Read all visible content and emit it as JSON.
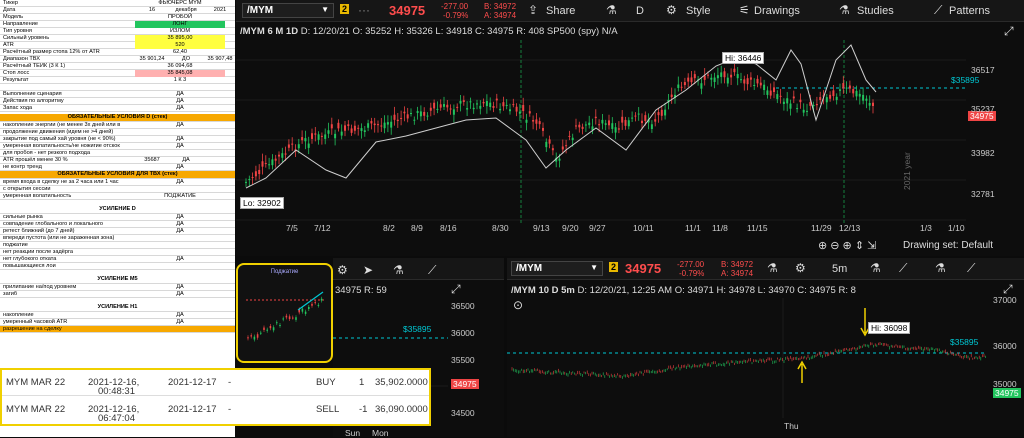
{
  "sheet": {
    "rows": [
      {
        "label": "Тикер",
        "values": [
          "ФЬЮЧЕРС MYM"
        ]
      },
      {
        "label": "Дата",
        "values": [
          "16",
          "декабря",
          "2021"
        ]
      },
      {
        "label": "Модель",
        "values": [
          "ПРОБОЙ"
        ]
      },
      {
        "label": "Направление",
        "values": [
          "ЛОНГ"
        ]
      },
      {
        "label": "Тип уровня",
        "values": [
          "ИЗЛОМ"
        ]
      },
      {
        "label": "Сильный уровень",
        "values": [
          "35 895,00"
        ]
      },
      {
        "label": "ATR",
        "values": [
          "520"
        ]
      },
      {
        "label": "Расчётный размер стопа 12% от ATR",
        "values": [
          "62,40"
        ]
      },
      {
        "label": "Диапазон ТВХ",
        "values": [
          "35 901,24",
          "ДО",
          "35 907,48"
        ]
      },
      {
        "label": "Расчётный ТЕЙК (3 К 1)",
        "values": [
          "36 094,68"
        ]
      },
      {
        "label": "Стоп лосс",
        "values": [
          "35 845,08"
        ]
      },
      {
        "label": "Результат",
        "values": [
          "1 К 3"
        ]
      },
      {
        "label": "",
        "values": []
      },
      {
        "label": "Выполнение сценария",
        "values": [
          "ДА"
        ]
      },
      {
        "label": "Действия по алгоритму",
        "values": [
          "ДА"
        ]
      },
      {
        "label": "Запас хода",
        "values": [
          "ДА"
        ]
      }
    ],
    "cond1_title": "ОБЯЗАТЕЛЬНЫЕ УСЛОВИЯ D (стек)",
    "cond1": [
      {
        "label": "накопление энергии (не менее 3х дней или в",
        "value": "ДА"
      },
      {
        "label": "продолжение движения (идем не >4 дней)",
        "value": ""
      },
      {
        "label": "закрытие под самый хай уровня (не < 90%)",
        "value": "ДА"
      },
      {
        "label": "умеренная волатильность/не ножигие отскок",
        "value": "ДА"
      },
      {
        "label": "для пробоя - нет резкого подхода",
        "value": ""
      },
      {
        "label": "ATR прошёл менее 30 %",
        "value": "ДА",
        "extra": "35687"
      },
      {
        "label": "не контр тренд",
        "value": "ДА"
      }
    ],
    "cond2_title": "ОБЯЗАТЕЛЬНЫЕ УСЛОВИЯ ДЛЯ ТВХ (стек)",
    "cond2": [
      {
        "label": "время входа в сделку не за 2 часа или 1 час",
        "value": "ДА"
      },
      {
        "label": "с открытия сессии",
        "value": ""
      },
      {
        "label": "умеренная волатильность",
        "value": "ПОДЖАТИЕ"
      }
    ],
    "cond3_title": "УСИЛЕНИЕ D",
    "cond3": [
      {
        "label": "сильные рынка",
        "value": "ДА"
      },
      {
        "label": "совпадение глобального и локального",
        "value": "ДА"
      },
      {
        "label": "ретест ближний (до 7 дней)",
        "value": "ДА"
      },
      {
        "label": "впереди пустота (или не зараженная зона)",
        "value": ""
      },
      {
        "label": "поджатие",
        "value": ""
      },
      {
        "label": "нет реакции после задёрга",
        "value": ""
      },
      {
        "label": "нет глубокого отката",
        "value": "ДА"
      },
      {
        "label": "повышающиеся лои",
        "value": ""
      }
    ],
    "cond4_title": "УСИЛЕНИЕ M5",
    "cond4": [
      {
        "label": "прилипание на/под уровнем",
        "value": "ДА"
      },
      {
        "label": "загиб",
        "value": "ДА"
      }
    ],
    "cond5_title": "УСИЛЕНИЕ H1",
    "cond5": [
      {
        "label": "накопление",
        "value": "ДА"
      },
      {
        "label": "умеренный часовой ATR",
        "value": "ДА"
      },
      {
        "label": "разрешение на сделку",
        "value": ""
      }
    ]
  },
  "thumb": {
    "title": "Поджатие"
  },
  "top": {
    "symbol": "/MYM",
    "badge": "2",
    "price": "34975",
    "change": "-277.00",
    "change_pct": "-0.79%",
    "bid": "B: 34972",
    "ask": "A: 34974",
    "share": "Share",
    "interval": "D",
    "style": "Style",
    "drawings": "Drawings",
    "studies": "Studies",
    "patterns": "Patterns",
    "info": {
      "name": "/MYM 6 M 1D",
      "d": "D: 12/20/21",
      "o": "O: 35252",
      "h": "H: 35326",
      "l": "L: 34918",
      "c": "C: 34975",
      "r": "R: 408",
      "cmp": "SP500 (spy)",
      "na": "N/A"
    },
    "hi_label": "Hi: 36446",
    "lo_label": "Lo: 32902",
    "level": "$35895",
    "price_tag": "34975",
    "yticks": [
      "36517",
      "35237",
      "33982",
      "32781"
    ],
    "xticks": [
      "7/5",
      "7/12",
      "8/2",
      "8/9",
      "8/16",
      "8/30",
      "9/13",
      "9/20",
      "9/27",
      "10/11",
      "11/1",
      "11/8",
      "11/15",
      "11/29",
      "12/13",
      "1/3",
      "1/10"
    ],
    "watermark": "2021 year",
    "drawing_set": "Drawing set: Default"
  },
  "mid": {
    "info": "34975 R: 59",
    "level": "$35895",
    "price_tag": "34975",
    "yticks": [
      "36500",
      "36000",
      "35500",
      "35000",
      "34500"
    ],
    "xticks": [
      "Thu",
      "Sun",
      "Mon"
    ]
  },
  "bot": {
    "symbol": "/MYM",
    "badge": "2",
    "price": "34975",
    "change": "-277.00",
    "change_pct": "-0.79%",
    "bid": "B: 34972",
    "ask": "A: 34974",
    "interval": "5m",
    "info": {
      "name": "/MYM 10 D 5m",
      "d": "D: 12/20/21, 12:25 AM",
      "o": "O: 34971",
      "h": "H: 34978",
      "l": "L: 34970",
      "c": "C: 34975",
      "r": "R: 8"
    },
    "hi_label": "Hi: 36098",
    "level": "$35895",
    "price_tag": "34975",
    "yticks": [
      "37000",
      "36000",
      "35000"
    ],
    "xticks": [
      "Thu"
    ]
  },
  "trades": [
    {
      "symbol": "MYM MAR 22",
      "date1": "2021-12-16,",
      "time1": "00:48:31",
      "date2": "2021-12-17",
      "dash": "-",
      "side": "BUY",
      "qty": "1",
      "price": "35,902.0000"
    },
    {
      "symbol": "MYM MAR 22",
      "date1": "2021-12-16,",
      "time1": "06:47:04",
      "date2": "2021-12-17",
      "dash": "-",
      "side": "SELL",
      "qty": "-1",
      "price": "36,090.0000"
    }
  ],
  "colors": {
    "green": "#22c55e",
    "red": "#ef4444",
    "level": "#00c8d4",
    "accent": "#f7a800",
    "yellow": "#f0d000"
  }
}
